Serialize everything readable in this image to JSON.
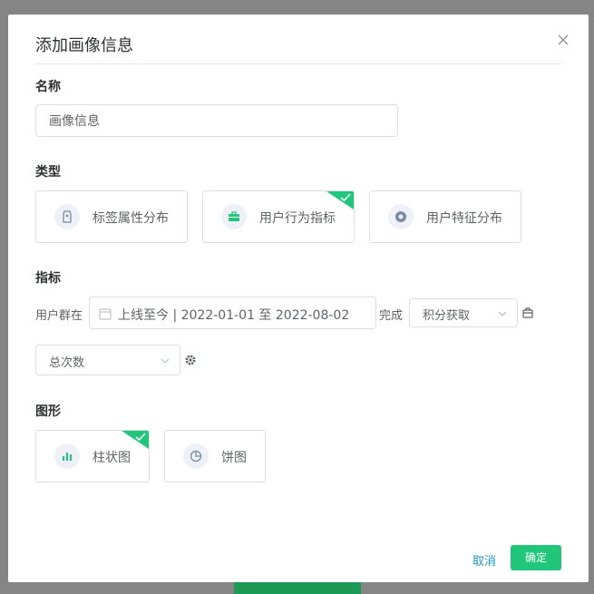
{
  "dialog": {
    "title": "添加画像信息",
    "close_icon": "close-icon"
  },
  "name_section": {
    "label": "名称",
    "value": "画像信息"
  },
  "type_section": {
    "label": "类型",
    "options": [
      {
        "label": "标签属性分布",
        "icon": "tag-icon",
        "selected": false
      },
      {
        "label": "用户行为指标",
        "icon": "briefcase-icon",
        "selected": true
      },
      {
        "label": "用户特征分布",
        "icon": "target-icon",
        "selected": false
      }
    ]
  },
  "metric_section": {
    "label": "指标",
    "prefix": "用户群在",
    "date_range": "上线至今 | 2022-01-01 至 2022-08-02",
    "infix": "完成",
    "event_select": "积分获取",
    "aggregate_select": "总次数"
  },
  "chart_section": {
    "label": "图形",
    "options": [
      {
        "label": "柱状图",
        "icon": "bar-chart-icon",
        "selected": true
      },
      {
        "label": "饼图",
        "icon": "pie-chart-icon",
        "selected": false
      }
    ]
  },
  "footer": {
    "cancel": "取消",
    "confirm": "确定"
  },
  "colors": {
    "accent": "#20c77a",
    "link": "#1a9ad6",
    "overlay": "#8c8c8c"
  }
}
